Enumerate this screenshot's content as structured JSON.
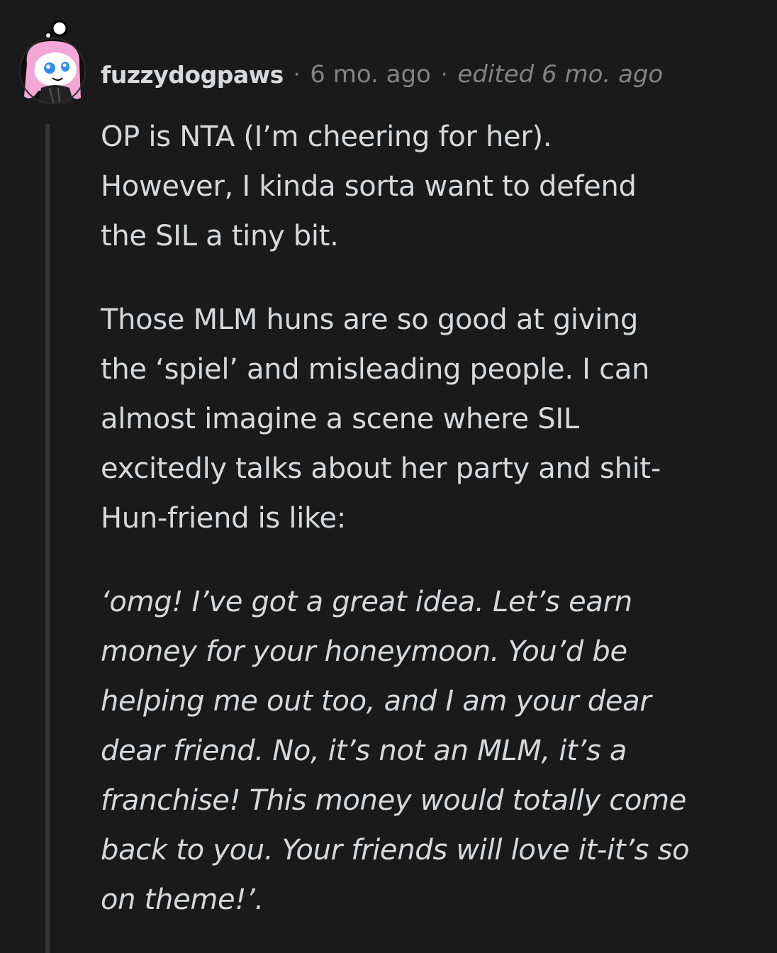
{
  "comment": {
    "author": "fuzzydogpaws",
    "separator": "·",
    "posted": "6 mo. ago",
    "edited": "edited 6 mo. ago",
    "paragraphs": [
      "OP is NTA (I’m cheering for her).\nHowever, I kinda sorta want to defend\nthe SIL a tiny bit.",
      "Those MLM huns are so good at giving\nthe ‘spiel’ and misleading people. I can\nalmost imagine a scene where SIL\nexcitedly talks about her party and shit-\nHun-friend is like:"
    ],
    "quote": "‘omg! I’ve got a great idea. Let’s earn\nmoney for your honeymoon. You’d be\nhelping me out too, and I am your dear\ndear friend. No, it’s not an MLM, it’s a\nfranchise! This money would totally come\nback to you. Your friends will love it-it’s so\non theme!’."
  },
  "colors": {
    "background": "#1a1a1b",
    "text": "#d7dadc",
    "meta": "#818384",
    "thread_line": "#343536",
    "avatar_hair": "#f4a6d7",
    "avatar_eye": "#2e8ff0"
  },
  "icons": {
    "avatar": "snoo-avatar-icon"
  }
}
